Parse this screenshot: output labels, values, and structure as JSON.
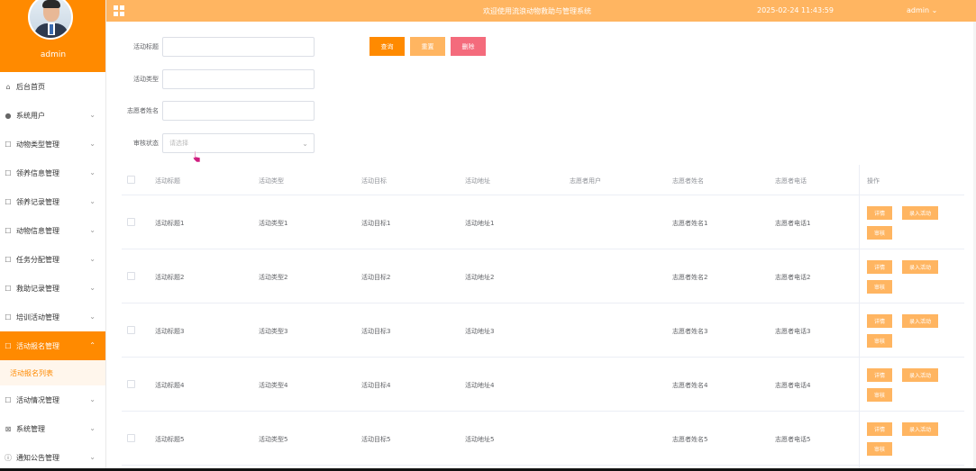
{
  "app": {
    "title": "欢迎使用流浪动物救助与管理系统",
    "datetime": "2025-02-24 11:43:59",
    "user": "admin ⌄"
  },
  "profile": {
    "name": "admin"
  },
  "sidebar": {
    "items": [
      {
        "label": "后台首页",
        "icon": "home-icon",
        "glyph": "⌂",
        "chevron": false,
        "active": false
      },
      {
        "label": "系统用户",
        "icon": "user-icon",
        "glyph": "●",
        "chevron": true,
        "active": false
      },
      {
        "label": "动物类型管理",
        "icon": "doc-icon",
        "glyph": "☐",
        "chevron": true,
        "active": false
      },
      {
        "label": "领养信息管理",
        "icon": "doc-icon",
        "glyph": "☐",
        "chevron": true,
        "active": false
      },
      {
        "label": "领养记录管理",
        "icon": "doc-icon",
        "glyph": "☐",
        "chevron": true,
        "active": false
      },
      {
        "label": "动物信息管理",
        "icon": "doc-icon",
        "glyph": "☐",
        "chevron": true,
        "active": false
      },
      {
        "label": "任务分配管理",
        "icon": "doc-icon",
        "glyph": "☐",
        "chevron": true,
        "active": false
      },
      {
        "label": "救助记录管理",
        "icon": "doc-icon",
        "glyph": "☐",
        "chevron": true,
        "active": false
      },
      {
        "label": "培训活动管理",
        "icon": "doc-icon",
        "glyph": "☐",
        "chevron": true,
        "active": false
      },
      {
        "label": "活动报名管理",
        "icon": "doc-icon",
        "glyph": "☐",
        "chevron": true,
        "active": true
      },
      {
        "label": "活动情况管理",
        "icon": "doc-icon",
        "glyph": "☐",
        "chevron": true,
        "active": false
      },
      {
        "label": "系统管理",
        "icon": "settings-icon",
        "glyph": "⊠",
        "chevron": true,
        "active": false
      },
      {
        "label": "通知公告管理",
        "icon": "info-icon",
        "glyph": "ⓘ",
        "chevron": true,
        "active": false
      }
    ],
    "sub_item": "活动报名列表"
  },
  "search": {
    "title_label": "活动标题",
    "type_label": "活动类型",
    "volunteer_label": "志愿者姓名",
    "status_label": "审核状态",
    "status_placeholder": "请选择",
    "query": "查询",
    "reset": "重置",
    "delete": "删除"
  },
  "table": {
    "headers": [
      "活动标题",
      "活动类型",
      "活动目标",
      "活动地址",
      "志愿者用户",
      "志愿者姓名",
      "志愿者电话",
      "操作"
    ],
    "rows": [
      {
        "title": "活动标题1",
        "type": "活动类型1",
        "goal": "活动目标1",
        "address": "活动地址1",
        "user": "",
        "name": "志愿者姓名1",
        "phone": "志愿者电话1"
      },
      {
        "title": "活动标题2",
        "type": "活动类型2",
        "goal": "活动目标2",
        "address": "活动地址2",
        "user": "",
        "name": "志愿者姓名2",
        "phone": "志愿者电话2"
      },
      {
        "title": "活动标题3",
        "type": "活动类型3",
        "goal": "活动目标3",
        "address": "活动地址3",
        "user": "",
        "name": "志愿者姓名3",
        "phone": "志愿者电话3"
      },
      {
        "title": "活动标题4",
        "type": "活动类型4",
        "goal": "活动目标4",
        "address": "活动地址4",
        "user": "",
        "name": "志愿者姓名4",
        "phone": "志愿者电话4"
      },
      {
        "title": "活动标题5",
        "type": "活动类型5",
        "goal": "活动目标5",
        "address": "活动地址5",
        "user": "",
        "name": "志愿者姓名5",
        "phone": "志愿者电话5"
      }
    ],
    "actions": {
      "detail": "详情",
      "join": "录入活动",
      "review": "审核"
    }
  },
  "colors": {
    "primary": "#ff8a00",
    "light": "#ffb561",
    "danger": "#f46b7c"
  }
}
